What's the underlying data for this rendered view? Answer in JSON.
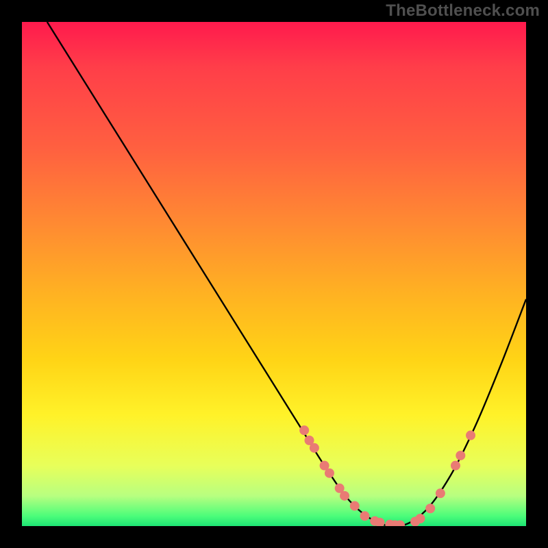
{
  "watermark": "TheBottleneck.com",
  "colors": {
    "curve_stroke": "#000000",
    "marker_fill": "#e97b74",
    "marker_stroke": "#e97b74",
    "frame_bg": "#000000"
  },
  "chart_data": {
    "type": "line",
    "title": "",
    "xlabel": "",
    "ylabel": "",
    "xlim": [
      0,
      100
    ],
    "ylim": [
      0,
      100
    ],
    "curve": [
      {
        "x": 5,
        "y": 100
      },
      {
        "x": 10,
        "y": 92
      },
      {
        "x": 20,
        "y": 76
      },
      {
        "x": 30,
        "y": 60
      },
      {
        "x": 40,
        "y": 44
      },
      {
        "x": 50,
        "y": 28
      },
      {
        "x": 55,
        "y": 20
      },
      {
        "x": 60,
        "y": 12
      },
      {
        "x": 65,
        "y": 5
      },
      {
        "x": 70,
        "y": 1
      },
      {
        "x": 75,
        "y": 0
      },
      {
        "x": 80,
        "y": 3
      },
      {
        "x": 85,
        "y": 10
      },
      {
        "x": 90,
        "y": 20
      },
      {
        "x": 95,
        "y": 32
      },
      {
        "x": 100,
        "y": 45
      }
    ],
    "markers": [
      {
        "x": 56,
        "y": 19
      },
      {
        "x": 57,
        "y": 17
      },
      {
        "x": 58,
        "y": 15.5
      },
      {
        "x": 60,
        "y": 12
      },
      {
        "x": 61,
        "y": 10.5
      },
      {
        "x": 63,
        "y": 7.5
      },
      {
        "x": 64,
        "y": 6
      },
      {
        "x": 66,
        "y": 4
      },
      {
        "x": 68,
        "y": 2
      },
      {
        "x": 70,
        "y": 1
      },
      {
        "x": 71,
        "y": 0.7
      },
      {
        "x": 73,
        "y": 0.3
      },
      {
        "x": 74,
        "y": 0.2
      },
      {
        "x": 75,
        "y": 0.2
      },
      {
        "x": 78,
        "y": 0.9
      },
      {
        "x": 79,
        "y": 1.5
      },
      {
        "x": 81,
        "y": 3.5
      },
      {
        "x": 83,
        "y": 6.5
      },
      {
        "x": 86,
        "y": 12
      },
      {
        "x": 87,
        "y": 14
      },
      {
        "x": 89,
        "y": 18
      }
    ],
    "grid": false,
    "legend": false
  }
}
